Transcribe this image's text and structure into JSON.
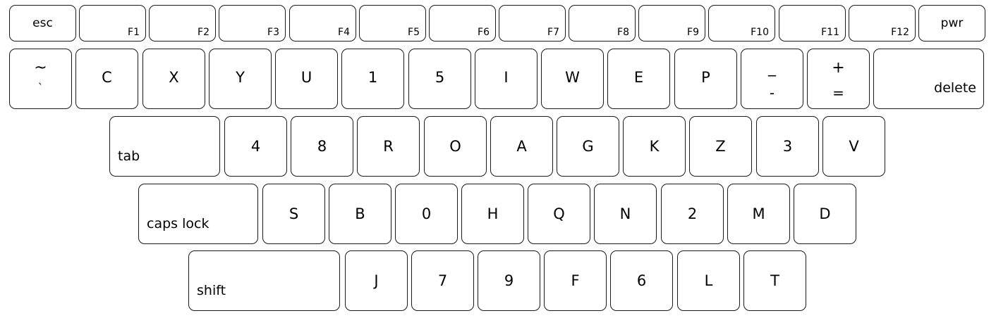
{
  "keyboard": {
    "row_function": [
      {
        "label": "esc",
        "name": "esc"
      },
      {
        "label": "F1",
        "name": "f1"
      },
      {
        "label": "F2",
        "name": "f2"
      },
      {
        "label": "F3",
        "name": "f3"
      },
      {
        "label": "F4",
        "name": "f4"
      },
      {
        "label": "F5",
        "name": "f5"
      },
      {
        "label": "F6",
        "name": "f6"
      },
      {
        "label": "F7",
        "name": "f7"
      },
      {
        "label": "F8",
        "name": "f8"
      },
      {
        "label": "F9",
        "name": "f9"
      },
      {
        "label": "F10",
        "name": "f10"
      },
      {
        "label": "F11",
        "name": "f11"
      },
      {
        "label": "F12",
        "name": "f12"
      },
      {
        "label": "pwr",
        "name": "pwr"
      }
    ],
    "row_number": [
      {
        "top": "~",
        "bottom": "`",
        "name": "tilde"
      },
      {
        "label": "C",
        "name": "c"
      },
      {
        "label": "X",
        "name": "x"
      },
      {
        "label": "Y",
        "name": "y"
      },
      {
        "label": "U",
        "name": "u"
      },
      {
        "label": "1",
        "name": "1"
      },
      {
        "label": "5",
        "name": "5"
      },
      {
        "label": "I",
        "name": "i"
      },
      {
        "label": "W",
        "name": "w"
      },
      {
        "label": "E",
        "name": "e"
      },
      {
        "label": "P",
        "name": "p"
      },
      {
        "top": "_",
        "bottom": "-",
        "name": "minus"
      },
      {
        "top": "+",
        "bottom": "=",
        "name": "equals"
      },
      {
        "label": "delete",
        "name": "delete"
      }
    ],
    "row_tab": [
      {
        "label": "tab",
        "name": "tab"
      },
      {
        "label": "4",
        "name": "4"
      },
      {
        "label": "8",
        "name": "8"
      },
      {
        "label": "R",
        "name": "r"
      },
      {
        "label": "O",
        "name": "o"
      },
      {
        "label": "A",
        "name": "a"
      },
      {
        "label": "G",
        "name": "g"
      },
      {
        "label": "K",
        "name": "k"
      },
      {
        "label": "Z",
        "name": "z"
      },
      {
        "label": "3",
        "name": "3"
      },
      {
        "label": "V",
        "name": "v"
      }
    ],
    "row_caps": [
      {
        "label": "caps lock",
        "name": "caps-lock"
      },
      {
        "label": "S",
        "name": "s"
      },
      {
        "label": "B",
        "name": "b"
      },
      {
        "label": "0",
        "name": "0"
      },
      {
        "label": "H",
        "name": "h"
      },
      {
        "label": "Q",
        "name": "q"
      },
      {
        "label": "N",
        "name": "n"
      },
      {
        "label": "2",
        "name": "2"
      },
      {
        "label": "M",
        "name": "m"
      },
      {
        "label": "D",
        "name": "d"
      }
    ],
    "row_shift": [
      {
        "label": "shift",
        "name": "shift"
      },
      {
        "label": "J",
        "name": "j"
      },
      {
        "label": "7",
        "name": "7"
      },
      {
        "label": "9",
        "name": "9"
      },
      {
        "label": "F",
        "name": "f"
      },
      {
        "label": "6",
        "name": "6"
      },
      {
        "label": "L",
        "name": "l"
      },
      {
        "label": "T",
        "name": "t"
      }
    ]
  }
}
